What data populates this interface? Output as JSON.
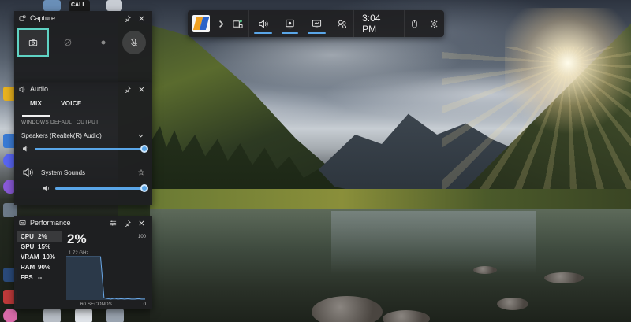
{
  "desktop_icon_text": "CALL",
  "gamebar": {
    "time": "3:04 PM",
    "accent": "#5aa6e8"
  },
  "capture": {
    "title": "Capture"
  },
  "audio": {
    "title": "Audio",
    "tabs": [
      {
        "label": "MIX",
        "active": true
      },
      {
        "label": "VOICE",
        "active": false
      }
    ],
    "section_label": "WINDOWS DEFAULT OUTPUT",
    "device": "Speakers (Realtek(R) Audio)",
    "device_volume": 1.0,
    "apps": [
      {
        "name": "System Sounds",
        "volume": 1.0
      }
    ]
  },
  "performance": {
    "title": "Performance",
    "metrics": [
      {
        "name": "CPU",
        "value": "2%"
      },
      {
        "name": "GPU",
        "value": "15%"
      },
      {
        "name": "VRAM",
        "value": "10%"
      },
      {
        "name": "RAM",
        "value": "90%"
      },
      {
        "name": "FPS",
        "value": "--"
      }
    ],
    "selected_value": "2%",
    "selected_sub": "1.72 GHz",
    "graph_max": "100",
    "graph_min": "0",
    "graph_xlabel": "60 SECONDS",
    "graph_values": [
      98,
      98,
      98,
      98,
      98,
      98,
      98,
      98,
      98,
      98,
      98,
      5,
      3,
      2,
      4,
      2,
      3,
      2,
      3,
      2,
      2,
      3,
      2,
      2
    ]
  }
}
